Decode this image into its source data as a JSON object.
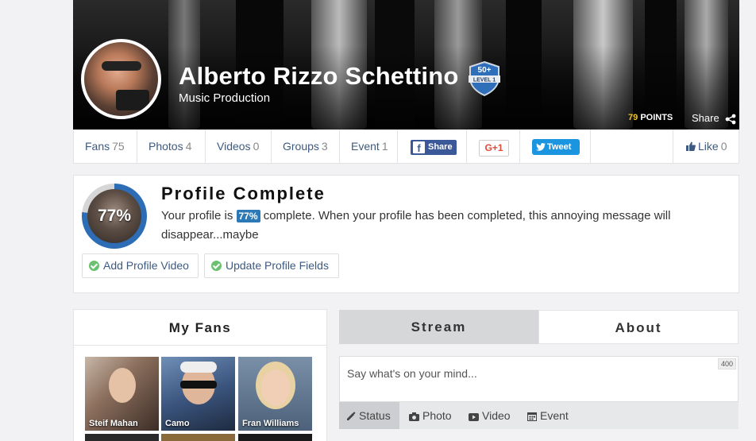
{
  "profile": {
    "name": "Alberto Rizzo Schettino",
    "subtitle": "Music Production",
    "badge_top": "50+",
    "badge_bottom": "LEVEL 1",
    "points_value": "79",
    "points_label": "POINTS",
    "share_label": "Share"
  },
  "tabs": [
    {
      "label": "Fans",
      "count": "75"
    },
    {
      "label": "Photos",
      "count": "4"
    },
    {
      "label": "Videos",
      "count": "0"
    },
    {
      "label": "Groups",
      "count": "3"
    },
    {
      "label": "Event",
      "count": "1"
    }
  ],
  "social": {
    "facebook_label": "Share",
    "gplus_label": "G+1",
    "twitter_label": "Tweet",
    "like_label": "Like",
    "like_count": "0"
  },
  "profile_complete": {
    "percent_label": "77%",
    "percent_value": 0.77,
    "title": "Profile Complete",
    "msg_before": "Your profile is ",
    "msg_highlight": "77%",
    "msg_after": " complete. When your profile has been completed, this annoying message will disappear...maybe",
    "buttons": [
      "Add Profile Video",
      "Update Profile Fields"
    ]
  },
  "fans": {
    "title": "My Fans",
    "items": [
      {
        "name": "Steif Mahan"
      },
      {
        "name": "Camo"
      },
      {
        "name": "Fran Williams"
      }
    ]
  },
  "stream": {
    "tabs": [
      "Stream",
      "About"
    ],
    "placeholder": "Say what's on your mind...",
    "char_count": "400",
    "types": [
      "Status",
      "Photo",
      "Video",
      "Event"
    ]
  },
  "colors": {
    "accent_blue": "#2d6db5",
    "link": "#3d5a80",
    "facebook": "#3b5998",
    "twitter": "#1b95e0",
    "points": "#f0c419"
  }
}
